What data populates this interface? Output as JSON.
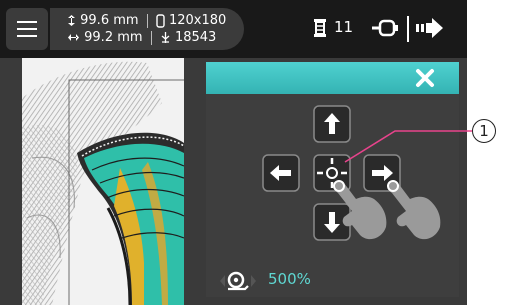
{
  "topbar": {
    "height_value": "99.6 mm",
    "width_value": "99.2 mm",
    "hoop_size": "120x180",
    "stitch_count": "18543",
    "needle_count": "11"
  },
  "icons": {
    "menu": "hamburger-menu-icon",
    "height": "vertical-arrow-icon",
    "width": "horizontal-arrow-icon",
    "hoop": "hoop-icon",
    "stitches": "stitch-icon",
    "needle": "needle-icon",
    "thread": "thread-feed-icon",
    "next": "next-step-icon",
    "close": "close-icon",
    "zoom": "zoom-icon"
  },
  "panel": {
    "zoom_value": "500%",
    "buttons": [
      "move-up",
      "move-left",
      "center",
      "move-right",
      "move-down"
    ]
  },
  "callout": {
    "number": "1"
  },
  "colors": {
    "accent": "#3cc2c0",
    "callout_line": "#e8438c",
    "topbar": "#191919",
    "panel": "#3e3e3e"
  }
}
